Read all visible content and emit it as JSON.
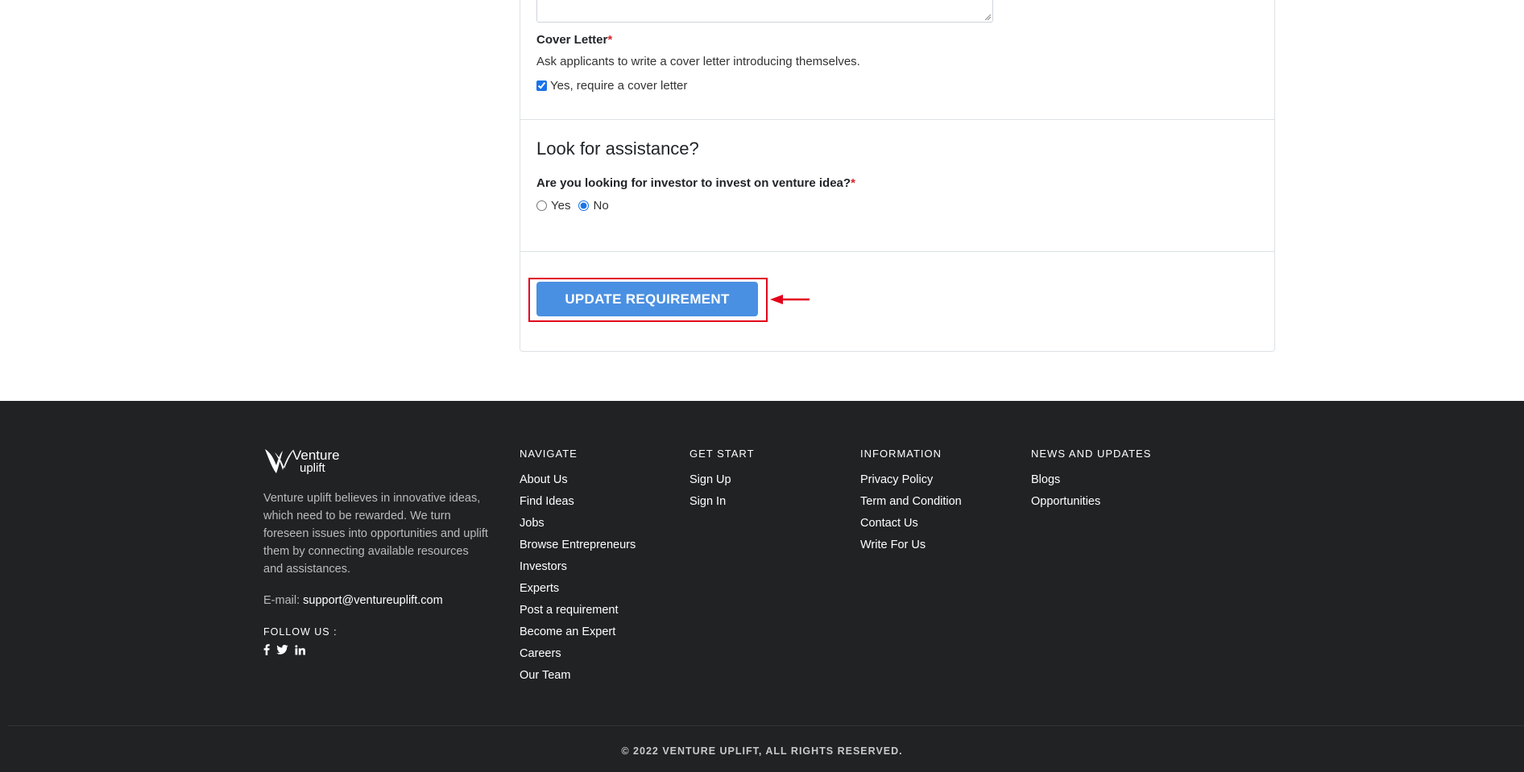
{
  "form": {
    "cover_letter": {
      "label": "Cover Letter",
      "required_mark": "*",
      "hint": "Ask applicants to write a cover letter introducing themselves.",
      "checkbox_label": "Yes, require a cover letter",
      "checked": true
    },
    "assistance": {
      "title": "Look for assistance?",
      "question": "Are you looking for investor to invest on venture idea?",
      "required_mark": "*",
      "options": [
        {
          "label": "Yes",
          "selected": false
        },
        {
          "label": "No",
          "selected": true
        }
      ]
    },
    "submit_label": "UPDATE REQUIREMENT"
  },
  "colors": {
    "button": "#4a90e2",
    "highlight": "#e3001b",
    "footer_bg": "#212224",
    "required": "#d9232d"
  },
  "footer": {
    "brand": {
      "line1": "Venture",
      "line2": "uplift"
    },
    "about": "Venture uplift believes in innovative ideas, which need to be rewarded. We turn foreseen issues into opportunities and uplift them by connecting available resources and assistances.",
    "email_label": "E-mail:",
    "email": "support@ventureuplift.com",
    "follow_label": "FOLLOW US :",
    "socials": [
      "facebook-icon",
      "twitter-icon",
      "linkedin-icon"
    ],
    "columns": [
      {
        "title": "NAVIGATE",
        "links": [
          "About Us",
          "Find Ideas",
          "Jobs",
          "Browse Entrepreneurs",
          "Investors",
          "Experts",
          "Post a requirement",
          "Become an Expert",
          "Careers",
          "Our Team"
        ]
      },
      {
        "title": "GET START",
        "links": [
          "Sign Up",
          "Sign In"
        ]
      },
      {
        "title": "INFORMATION",
        "links": [
          "Privacy Policy",
          "Term and Condition",
          "Contact Us",
          "Write For Us"
        ]
      },
      {
        "title": "NEWS AND UPDATES",
        "links": [
          "Blogs",
          "Opportunities"
        ]
      }
    ],
    "copyright": "© 2022 VENTURE UPLIFT, ALL RIGHTS RESERVED."
  }
}
